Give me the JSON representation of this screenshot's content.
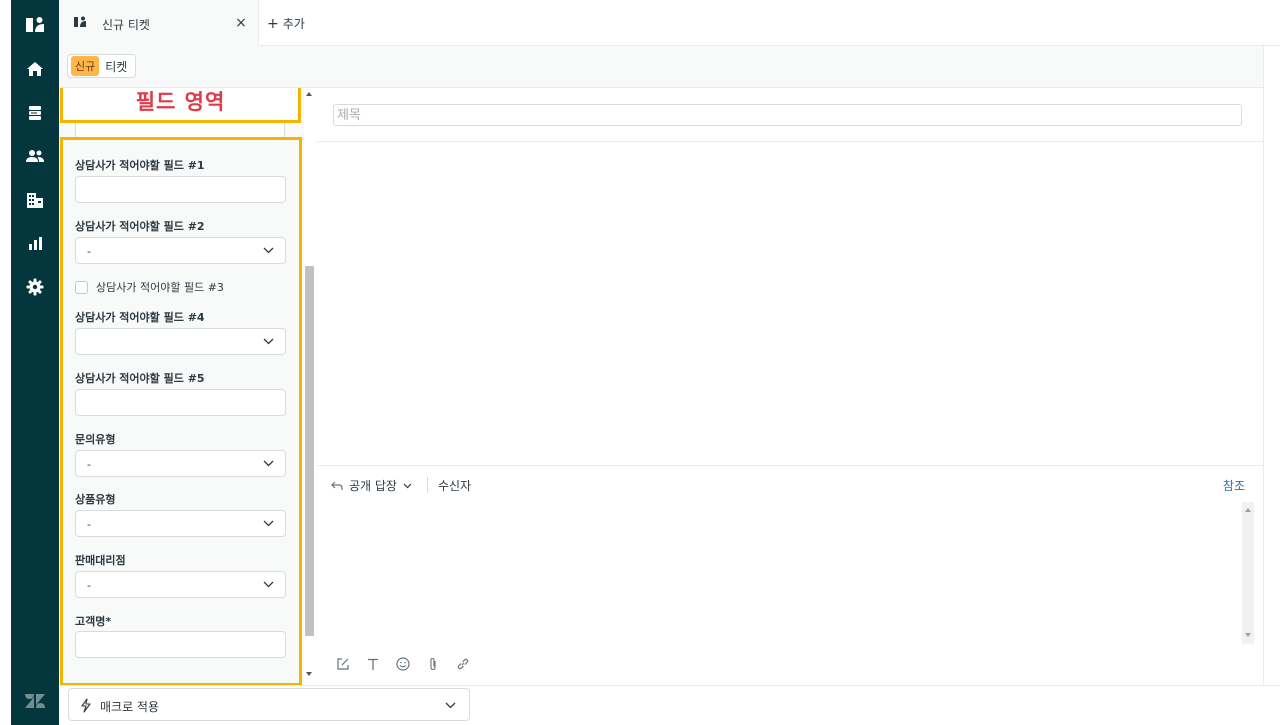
{
  "nav": {
    "items": [
      {
        "name": "home-icon"
      },
      {
        "name": "views-icon"
      },
      {
        "name": "customers-icon"
      },
      {
        "name": "organizations-icon"
      },
      {
        "name": "reporting-icon"
      },
      {
        "name": "admin-gear-icon"
      }
    ],
    "bottom_logo": "zendesk-logo-icon"
  },
  "tab": {
    "title": "신규 티켓",
    "close": "×"
  },
  "add_tab": {
    "plus": "+",
    "label": "추가"
  },
  "breadcrumb": {
    "badge": "신규",
    "label": "티켓"
  },
  "annotation": {
    "label": "필드 영역",
    "color": "#e0394a",
    "border_color": "#f4b400"
  },
  "fields": {
    "f1": {
      "label": "상담사가 적어야할 필드 #1"
    },
    "f2": {
      "label": "상담사가 적어야할 필드 #2",
      "value": "-"
    },
    "f3": {
      "label": "상담사가 적어야할 필드 #3"
    },
    "f4": {
      "label": "상담사가 적어야할 필드 #4",
      "value": ""
    },
    "f5": {
      "label": "상담사가 적어야할 필드 #5"
    },
    "inquiry_type": {
      "label": "문의유형",
      "value": "-"
    },
    "product_type": {
      "label": "상품유형",
      "value": "-"
    },
    "dealer": {
      "label": "판매대리점",
      "value": "-"
    },
    "customer_name": {
      "label": "고객명*"
    }
  },
  "subject": {
    "placeholder": "제목"
  },
  "composer": {
    "reply_label": "공개 답장",
    "recipient_label": "수신자",
    "cc_label": "참조"
  },
  "macro": {
    "label": "매크로 적용"
  },
  "colors": {
    "nav_bg": "#03363d",
    "accent": "#1f73b7",
    "badge": "#ffb648"
  }
}
